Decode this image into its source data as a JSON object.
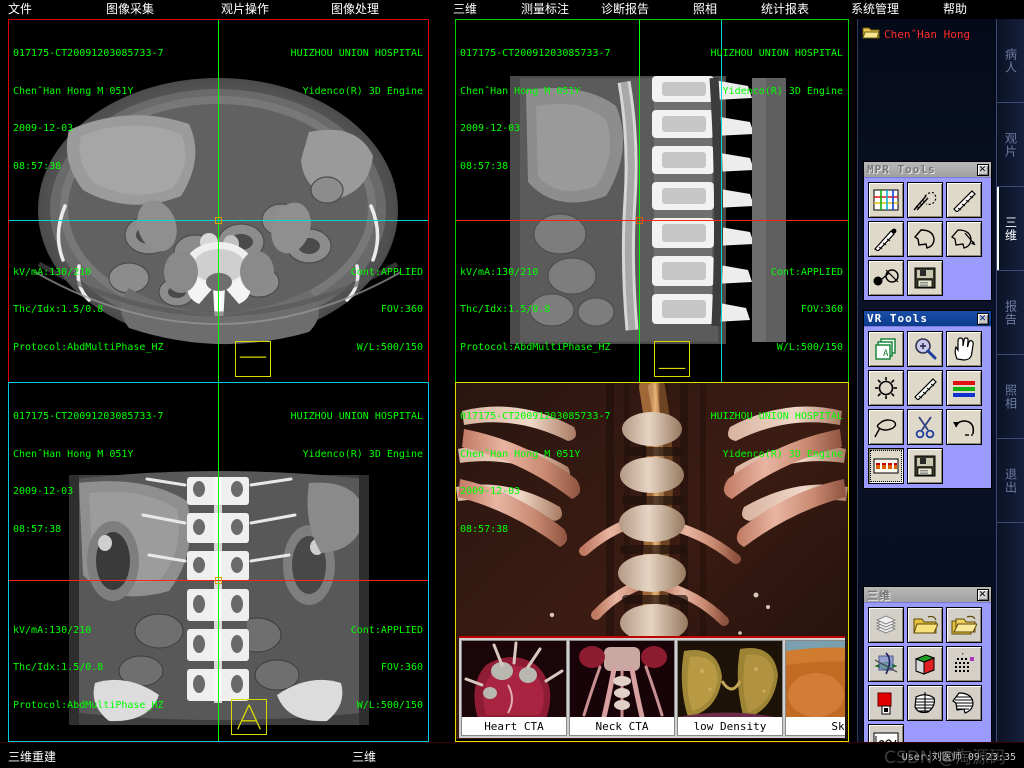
{
  "app": {
    "hospital": "HUIZHOU UNION HOSPITAL",
    "engine": "Yidenco(R) 3D Engine"
  },
  "menubar": {
    "items": [
      {
        "label": "文件"
      },
      {
        "label": "图像采集"
      },
      {
        "label": "观片操作"
      },
      {
        "label": "图像处理"
      },
      {
        "label": "三维"
      },
      {
        "label": "测量标注"
      },
      {
        "label": "诊断报告"
      },
      {
        "label": "照相"
      },
      {
        "label": "统计报表"
      },
      {
        "label": "系统管理"
      },
      {
        "label": "帮助"
      }
    ]
  },
  "study": {
    "accession": "017175-CT20091203085733-7",
    "patient_line": "ChenˆHan Hong M 051Y",
    "date": "2009-12-03",
    "time": "08:57:38",
    "kvma": "kV/mA:130/210",
    "thc_idx": "Thc/Idx:1.5/0.8",
    "protocol": "Protocol:AbdMultiPhase_HZ",
    "contrast": "Cont:APPLIED",
    "fov": "FOV:360",
    "wl": "W/L:500/150"
  },
  "viewports": [
    {
      "name": "axial",
      "border": "#e00000",
      "orientation_marker": "none"
    },
    {
      "name": "sagittal",
      "border": "#00d000",
      "orientation_marker": "none"
    },
    {
      "name": "coronal",
      "border": "#00c8e0",
      "orientation_marker": "A"
    },
    {
      "name": "vr",
      "border": "#e0e000",
      "orientation_marker": "none"
    }
  ],
  "sidebar": {
    "patient_label": "ChenˆHan Hong",
    "patient_icon": "folder-open-icon",
    "panels": [
      {
        "title": "MPR Tools",
        "state": "inactive",
        "close_label": "✕",
        "buttons": [
          {
            "name": "mpr-layout-grid-button",
            "icon": "grid-layout-icon"
          },
          {
            "name": "mpr-curve-measure-button",
            "icon": "curved-ruler-icon"
          },
          {
            "name": "mpr-ruler-button",
            "icon": "ruler-icon"
          },
          {
            "name": "mpr-point-measure-button",
            "icon": "ruler-point-icon"
          },
          {
            "name": "mpr-head-profile-button",
            "icon": "head-outline-icon"
          },
          {
            "name": "mpr-head-rotate-button",
            "icon": "head-rotate-icon"
          },
          {
            "name": "mpr-bullseye-button",
            "icon": "target-probe-icon"
          },
          {
            "name": "mpr-save-button",
            "icon": "floppy-save-icon"
          }
        ]
      },
      {
        "title": "VR Tools",
        "state": "active",
        "close_label": "✕",
        "buttons": [
          {
            "name": "vr-preset-cube-button",
            "icon": "cube-a-icon"
          },
          {
            "name": "vr-zoom-button",
            "icon": "magnifier-plus-icon"
          },
          {
            "name": "vr-pan-button",
            "icon": "hand-icon"
          },
          {
            "name": "vr-rotate-button",
            "icon": "sun-rotate-icon"
          },
          {
            "name": "vr-measure-button",
            "icon": "ruler-icon"
          },
          {
            "name": "vr-colormap-button",
            "icon": "color-bars-icon"
          },
          {
            "name": "vr-lasso-button",
            "icon": "lasso-icon"
          },
          {
            "name": "vr-cut-button",
            "icon": "scissors-icon"
          },
          {
            "name": "vr-undo-button",
            "icon": "undo-arrow-icon"
          },
          {
            "name": "vr-filmstrip-button",
            "icon": "filmstrip-icon",
            "pressed": true
          },
          {
            "name": "vr-save-button",
            "icon": "floppy-save-icon"
          }
        ]
      },
      {
        "title": "三维",
        "state": "inactive",
        "close_label": "✕",
        "buttons": [
          {
            "name": "3d-stack-button",
            "icon": "slice-stack-icon"
          },
          {
            "name": "3d-open-folder-button",
            "icon": "folder-open-icon"
          },
          {
            "name": "3d-multi-folder-button",
            "icon": "folders-icon"
          },
          {
            "name": "3d-mpr-axes-button",
            "icon": "mpr-axes-icon"
          },
          {
            "name": "3d-volume-cube-button",
            "icon": "colored-cube-icon"
          },
          {
            "name": "3d-grid-point-button",
            "icon": "dotted-grid-icon"
          },
          {
            "name": "3d-record-button",
            "icon": "red-square-record-icon"
          },
          {
            "name": "3d-mip-button",
            "icon": "striped-volume-icon"
          },
          {
            "name": "3d-head-mip-button",
            "icon": "striped-head-icon"
          },
          {
            "name": "3d-curve-graph-button",
            "icon": "waveform-graph-icon"
          }
        ]
      }
    ]
  },
  "rail": {
    "tabs": [
      {
        "label": "病人",
        "active": false
      },
      {
        "label": "观片",
        "active": false
      },
      {
        "label": "三维",
        "active": true
      },
      {
        "label": "报告",
        "active": false
      },
      {
        "label": "照相",
        "active": false
      },
      {
        "label": "退出",
        "active": false
      }
    ]
  },
  "vr_thumbnails": [
    {
      "caption": "Heart CTA"
    },
    {
      "caption": "Neck CTA"
    },
    {
      "caption": "low Density"
    },
    {
      "caption": "Sk"
    }
  ],
  "statusbar": {
    "left": "三维重建",
    "middle": "三维",
    "right": "User:刘医师  09:23:35",
    "watermark": "CSDN @淘源码"
  },
  "colors": {
    "accent_red": "#e00000",
    "accent_green": "#00d000",
    "accent_cyan": "#00c8e0",
    "accent_yellow": "#e0e000",
    "overlay_text": "#00ff00",
    "patient_text": "#ff2a2a",
    "panel_bg": "#9a9aff",
    "button_face": "#ded9c8",
    "title_active": "#0a3c8c"
  }
}
